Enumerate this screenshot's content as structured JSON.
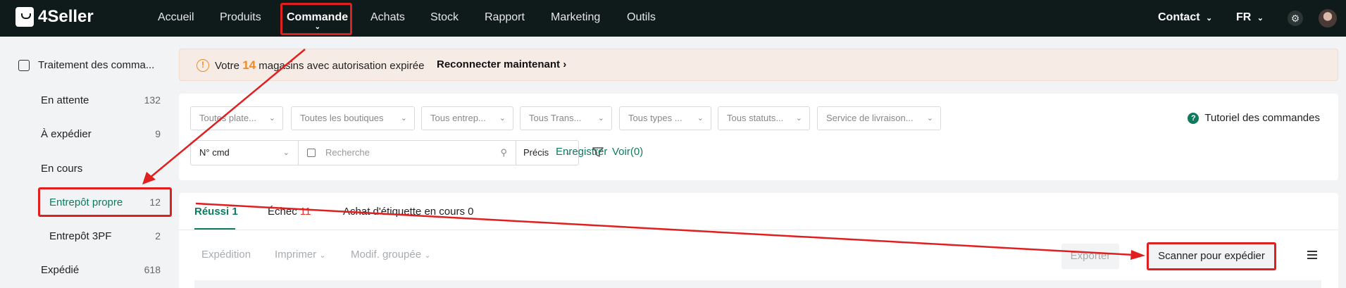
{
  "app": {
    "name": "4Seller"
  },
  "nav": {
    "items": [
      "Accueil",
      "Produits",
      "Commande",
      "Achats",
      "Stock",
      "Rapport",
      "Marketing",
      "Outils"
    ],
    "contact": "Contact",
    "lang": "FR"
  },
  "sidebar": {
    "section": "Traitement des comma...",
    "items": [
      {
        "label": "En attente",
        "count": "132"
      },
      {
        "label": "À expédier",
        "count": "9"
      },
      {
        "label": "En cours",
        "count": ""
      },
      {
        "label": "Entrepôt propre",
        "count": "12"
      },
      {
        "label": "Entrepôt 3PF",
        "count": "2"
      },
      {
        "label": "Expédié",
        "count": "618"
      }
    ]
  },
  "banner": {
    "prefix": "Votre",
    "count": "14",
    "suffix": "magasins avec autorisation expirée",
    "link": "Reconnecter maintenant ›"
  },
  "filters": {
    "selects": [
      "Toutes plate...",
      "Toutes les boutiques",
      "Tous entrep...",
      "Tous Trans...",
      "Tous types ...",
      "Tous statuts...",
      "Service de livraison..."
    ],
    "tutorial": "Tutoriel des commandes",
    "search_type": "N° cmd",
    "search_placeholder": "Recherche",
    "match": "Précis",
    "save": "Enregistrer",
    "view": "Voir(0)"
  },
  "results": {
    "tabs": [
      {
        "label": "Réussi",
        "count": "1"
      },
      {
        "label": "Échec",
        "count": "11"
      },
      {
        "label": "Achat d'étiquette en cours",
        "count": "0"
      }
    ],
    "actions": [
      "Expédition",
      "Imprimer",
      "Modif. groupée"
    ],
    "export": "Exporter",
    "scan": "Scanner pour expédier"
  },
  "colors": {
    "accent": "#0f7a5f",
    "annotation": "#e02020",
    "warning": "#f08a24",
    "nav_bg": "#0f1b1a"
  }
}
